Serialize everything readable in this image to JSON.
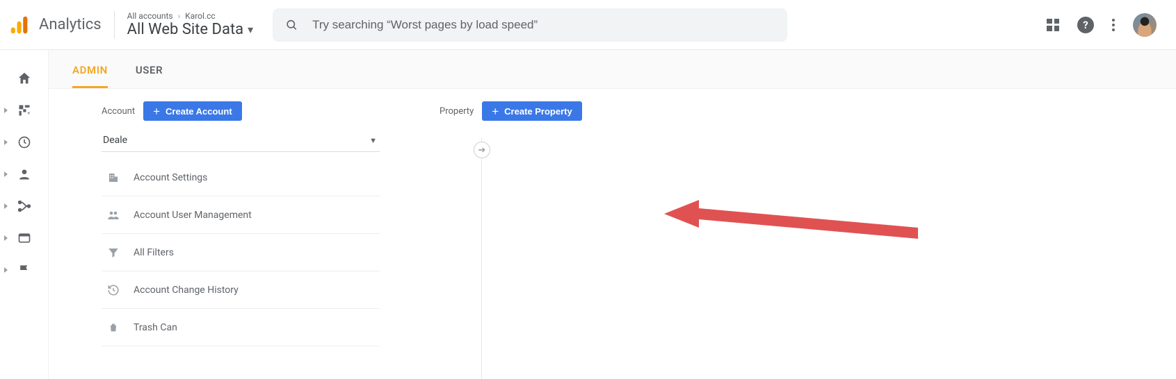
{
  "header": {
    "brand": "Analytics",
    "breadcrumb_prefix": "All accounts",
    "breadcrumb_account": "Karol.cc",
    "view_name": "All Web Site Data",
    "search_placeholder": "Try searching “Worst pages by load speed”"
  },
  "sidebar": {
    "items": [
      {
        "name": "home",
        "has_arrow": false
      },
      {
        "name": "customization",
        "has_arrow": true
      },
      {
        "name": "realtime",
        "has_arrow": true
      },
      {
        "name": "audience",
        "has_arrow": true
      },
      {
        "name": "acquisition",
        "has_arrow": true
      },
      {
        "name": "behavior",
        "has_arrow": true
      },
      {
        "name": "conversions",
        "has_arrow": true
      }
    ]
  },
  "tabs": {
    "admin": "ADMIN",
    "user": "USER",
    "active": "admin"
  },
  "admin": {
    "account": {
      "label": "Account",
      "create_btn": "Create Account",
      "selected": "Deale",
      "menu": [
        {
          "icon": "building",
          "label": "Account Settings"
        },
        {
          "icon": "people",
          "label": "Account User Management"
        },
        {
          "icon": "funnel",
          "label": "All Filters"
        },
        {
          "icon": "history",
          "label": "Account Change History"
        },
        {
          "icon": "trash",
          "label": "Trash Can"
        }
      ]
    },
    "property": {
      "label": "Property",
      "create_btn": "Create Property"
    }
  }
}
